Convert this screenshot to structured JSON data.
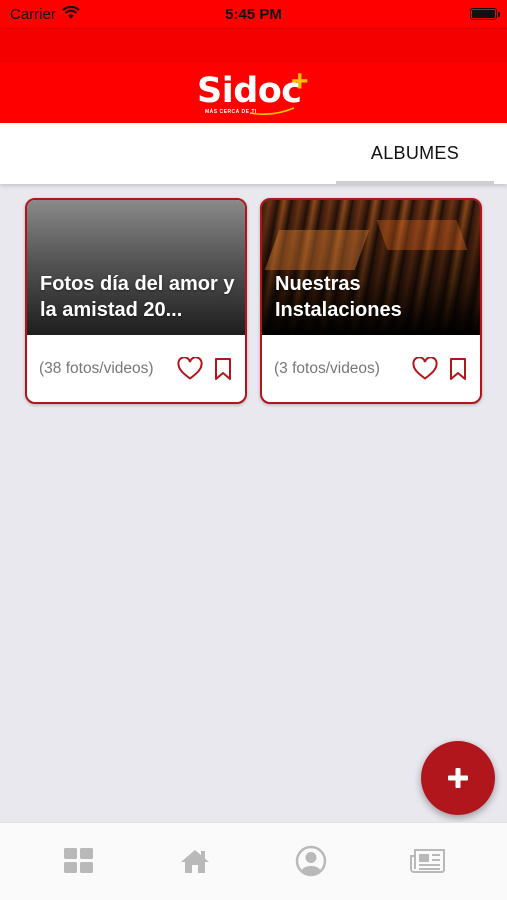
{
  "status_bar": {
    "carrier": "Carrier",
    "time": "5:45 PM"
  },
  "header": {
    "logo_text": "Sidoc",
    "logo_plus": "+",
    "tagline": "MÁS CERCA DE TI",
    "brand_color": "#ff0000",
    "accent_color": "#ffc400"
  },
  "tabs": [
    {
      "label": "ALBUMES",
      "selected": true
    }
  ],
  "albums": [
    {
      "title": "Fotos día del amor y la amistad 20...",
      "count": "(38 fotos/videos)",
      "cover": "gray-gradient",
      "icons": [
        "heart-icon",
        "bookmark-icon"
      ]
    },
    {
      "title": "Nuestras Instalaciones",
      "count": "(3 fotos/videos)",
      "cover": "photo",
      "icons": [
        "heart-icon",
        "bookmark-icon"
      ]
    }
  ],
  "fab": {
    "icon": "plus-icon",
    "color": "#b0161c"
  },
  "bottom_nav": [
    {
      "icon": "grid-icon"
    },
    {
      "icon": "home-icon"
    },
    {
      "icon": "profile-icon"
    },
    {
      "icon": "newspaper-icon"
    }
  ],
  "card_border_color": "#b0151a"
}
